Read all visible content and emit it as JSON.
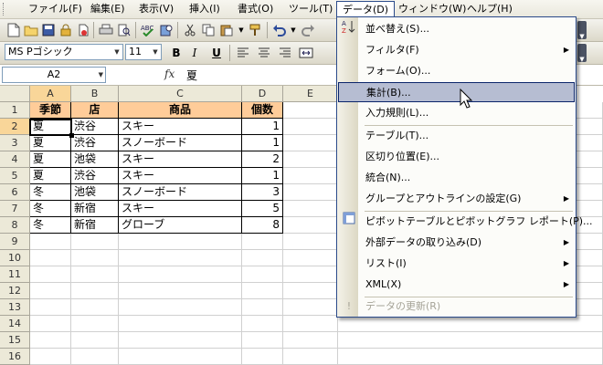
{
  "menubar": {
    "items": [
      {
        "label": "ファイル(F)"
      },
      {
        "label": "編集(E)"
      },
      {
        "label": "表示(V)"
      },
      {
        "label": "挿入(I)"
      },
      {
        "label": "書式(O)"
      },
      {
        "label": "ツール(T)"
      },
      {
        "label": "データ(D)"
      },
      {
        "label": "ウィンドウ(W)"
      },
      {
        "label": "ヘルプ(H)"
      }
    ]
  },
  "toolbar2": {
    "font_name": "MS Pゴシック",
    "font_size": "11",
    "bold_label": "B",
    "italic_label": "I",
    "underline_label": "U"
  },
  "formula_bar": {
    "name_box": "A2",
    "fx_label": "fx",
    "value": "夏"
  },
  "sheet": {
    "columns": [
      "A",
      "B",
      "C",
      "D",
      "E"
    ],
    "rows": [
      "1",
      "2",
      "3",
      "4",
      "5",
      "6",
      "7",
      "8",
      "9",
      "10",
      "11",
      "12",
      "13",
      "14",
      "15",
      "16"
    ],
    "headers": [
      "季節",
      "店",
      "商品",
      "個数"
    ],
    "data": [
      [
        "夏",
        "渋谷",
        "スキー",
        "1"
      ],
      [
        "夏",
        "渋谷",
        "スノーボード",
        "1"
      ],
      [
        "夏",
        "池袋",
        "スキー",
        "2"
      ],
      [
        "夏",
        "渋谷",
        "スキー",
        "1"
      ],
      [
        "冬",
        "池袋",
        "スノーボード",
        "3"
      ],
      [
        "冬",
        "新宿",
        "スキー",
        "5"
      ],
      [
        "冬",
        "新宿",
        "グローブ",
        "8"
      ]
    ],
    "active_cell": "A2",
    "header_color": "#ffcc99"
  },
  "data_menu": {
    "items": [
      {
        "label": "並べ替え(S)..."
      },
      {
        "label": "フィルタ(F)"
      },
      {
        "label": "フォーム(O)..."
      },
      {
        "label": "集計(B)..."
      },
      {
        "label": "入力規則(L)..."
      },
      {
        "label": "テーブル(T)..."
      },
      {
        "label": "区切り位置(E)..."
      },
      {
        "label": "統合(N)..."
      },
      {
        "label": "グループとアウトラインの設定(G)"
      },
      {
        "label": "ピボットテーブルとピボットグラフ レポート(P)..."
      },
      {
        "label": "外部データの取り込み(D)"
      },
      {
        "label": "リスト(I)"
      },
      {
        "label": "XML(X)"
      },
      {
        "label": "データの更新(R)"
      }
    ],
    "highlighted": "集計(B)...",
    "highlight_color": "#b6bdd2"
  }
}
